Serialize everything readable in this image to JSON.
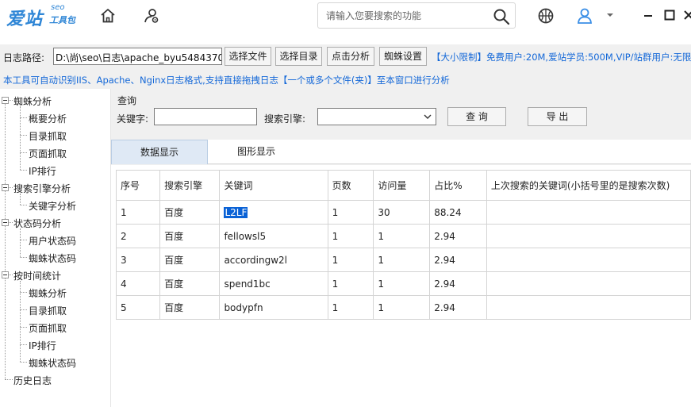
{
  "topbar": {
    "logo_main": "爱站",
    "logo_seo": "seo",
    "logo_sub": "工具包",
    "search_placeholder": "请输入您要搜索的功能",
    "icons": [
      "home-icon",
      "gear-user-icon",
      "basketball-icon",
      "user-icon",
      "chevron-down-icon",
      "minimize-icon",
      "maximize-icon",
      "close-icon"
    ]
  },
  "path_bar": {
    "label": "日志路径:",
    "value": "D:\\尚\\seo\\日志\\apache_byu5484370",
    "buttons": [
      "选择文件",
      "选择目录",
      "点击分析",
      "蜘蛛设置"
    ],
    "notice": "【大小限制】免费用户:20M,爱站学员:500M,VIP/站群用户:无限"
  },
  "tip": "本工具可自动识别IIS、Apache、Nginx日志格式,支持直接拖拽日志【一个或多个文件(夹)】至本窗口进行分析",
  "sidebar": [
    {
      "label": "蜘蛛分析",
      "children": [
        "概要分析",
        "目录抓取",
        "页面抓取",
        "IP排行"
      ]
    },
    {
      "label": "搜索引擎分析",
      "children": [
        "关键字分析"
      ]
    },
    {
      "label": "状态码分析",
      "children": [
        "用户状态码",
        "蜘蛛状态码"
      ]
    },
    {
      "label": "按时间统计",
      "children": [
        "蜘蛛分析",
        "目录抓取",
        "页面抓取",
        "IP排行",
        "蜘蛛状态码"
      ]
    },
    {
      "label": "历史日志",
      "children": []
    }
  ],
  "query": {
    "group_title": "查询",
    "keyword_label": "关键字:",
    "keyword_value": "",
    "engine_label": "搜索引擎:",
    "engine_value": "",
    "query_button": "查  询",
    "export_button": "导  出"
  },
  "tabs": [
    "数据显示",
    "图形显示"
  ],
  "table": {
    "columns": [
      "序号",
      "搜索引擎",
      "关键词",
      "页数",
      "访问量",
      "占比%",
      "上次搜索的关键词(小括号里的是搜索次数)"
    ],
    "rows": [
      [
        "1",
        "百度",
        "L2LF",
        "1",
        "30",
        "88.24",
        ""
      ],
      [
        "2",
        "百度",
        "fellowsl5",
        "1",
        "1",
        "2.94",
        ""
      ],
      [
        "3",
        "百度",
        "accordingw2l",
        "1",
        "1",
        "2.94",
        ""
      ],
      [
        "4",
        "百度",
        "spend1bc",
        "1",
        "1",
        "2.94",
        ""
      ],
      [
        "5",
        "百度",
        "bodypfn",
        "1",
        "1",
        "2.94",
        ""
      ]
    ]
  },
  "colors": {
    "brand": "#2f86d6",
    "notice": "#1468d8",
    "selection": "#0a62d6"
  }
}
